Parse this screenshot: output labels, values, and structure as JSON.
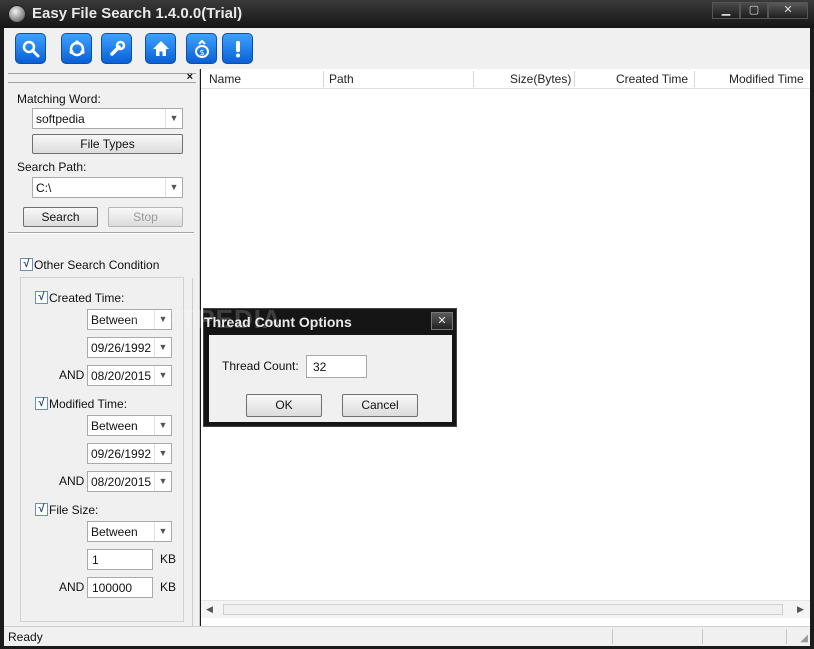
{
  "window": {
    "title": "Easy File Search 1.4.0.0(Trial)",
    "controls": {
      "minimize": "▁",
      "maximize": "▢",
      "close": "✕"
    }
  },
  "toolbar": {
    "buttons": [
      {
        "icon": "search-icon"
      },
      {
        "icon": "refresh-icon"
      },
      {
        "icon": "wrench-icon"
      },
      {
        "icon": "home-icon"
      },
      {
        "icon": "money-bag-icon"
      },
      {
        "icon": "exclamation-icon"
      }
    ],
    "accent": "#1a7fe8"
  },
  "left_panel": {
    "close_glyph": "×",
    "matching_word_label": "Matching Word:",
    "matching_word_value": "softpedia",
    "file_types_label": "File Types",
    "search_path_label": "Search Path:",
    "search_path_value": "C:\\",
    "search_label": "Search",
    "stop_label": "Stop",
    "other_condition_label": "Other Search Condition",
    "check_glyph": "√",
    "created": {
      "label": "Created Time:",
      "mode": "Between",
      "from": "09/26/1992",
      "and_label": "AND",
      "to": "08/20/2015"
    },
    "modified": {
      "label": "Modified Time:",
      "mode": "Between",
      "from": "09/26/1992",
      "and_label": "AND",
      "to": "08/20/2015"
    },
    "size": {
      "label": "File Size:",
      "mode": "Between",
      "min": "1",
      "min_unit": "KB",
      "and_label": "AND",
      "max": "100000",
      "max_unit": "KB"
    }
  },
  "results": {
    "columns": [
      "Name",
      "Path",
      "Size(Bytes)",
      "Created Time",
      "Modified Time"
    ]
  },
  "status": {
    "text": "Ready"
  },
  "dialog": {
    "title": "Thread Count Options",
    "watermark": "SOFTPEDIA",
    "close_glyph": "✕",
    "thread_count_label": "Thread Count:",
    "thread_count_value": "32",
    "ok_label": "OK",
    "cancel_label": "Cancel"
  }
}
